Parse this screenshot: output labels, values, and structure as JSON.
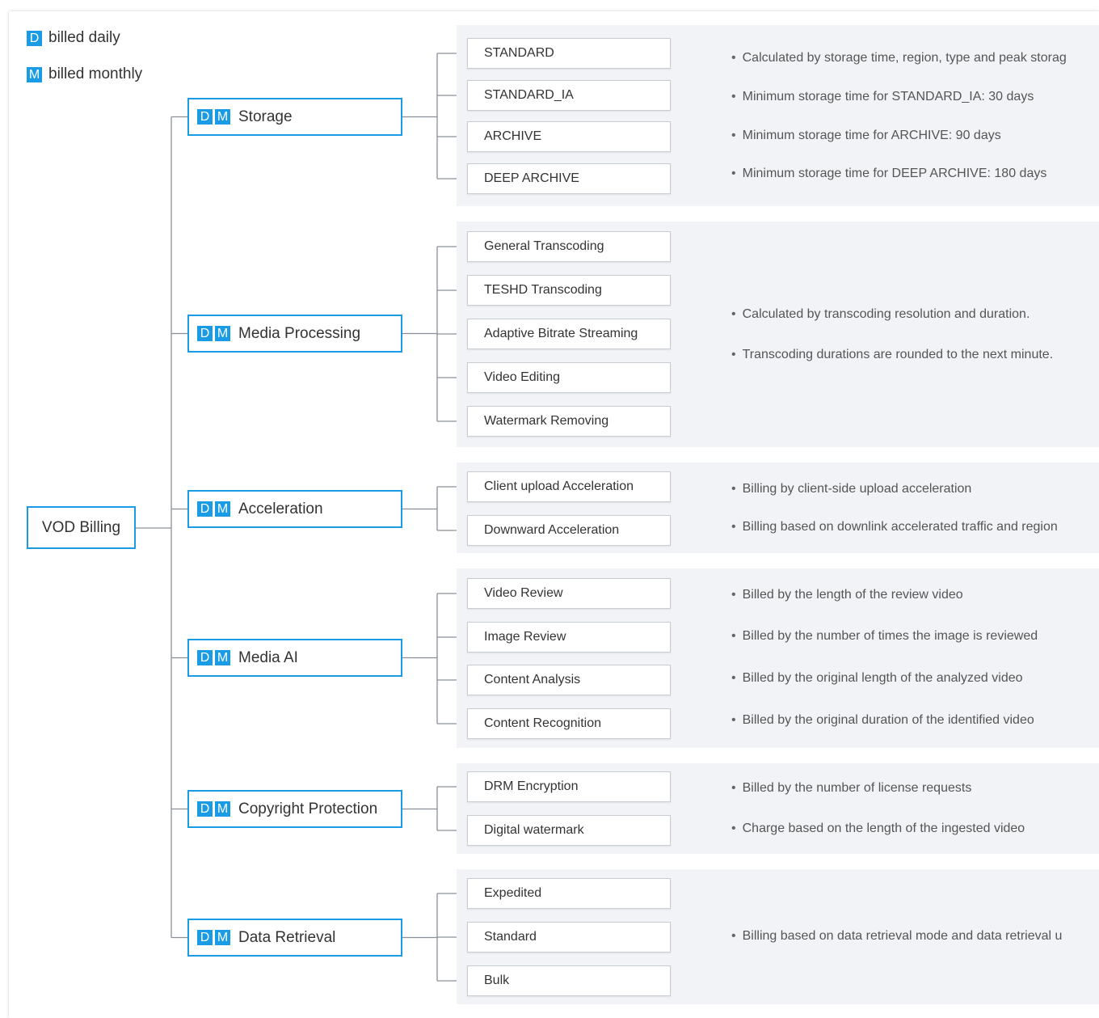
{
  "legend": [
    {
      "badge": "D",
      "label": "billed daily"
    },
    {
      "badge": "M",
      "label": "billed monthly"
    }
  ],
  "root": {
    "label": "VOD Billing"
  },
  "categories": [
    {
      "label": "Storage",
      "badges": [
        "D",
        "M"
      ],
      "items": [
        "STANDARD",
        "STANDARD_IA",
        "ARCHIVE",
        "DEEP ARCHIVE"
      ],
      "notes": [
        "Calculated by storage time, region, type and peak storag",
        "Minimum storage time for STANDARD_IA: 30 days",
        "Minimum storage time for ARCHIVE: 90 days",
        "Minimum storage time for DEEP ARCHIVE: 180 days"
      ]
    },
    {
      "label": "Media Processing",
      "badges": [
        "D",
        "M"
      ],
      "items": [
        "General Transcoding",
        "TESHD Transcoding",
        "Adaptive Bitrate Streaming",
        "Video Editing",
        "Watermark Removing"
      ],
      "notes": [
        "Calculated by transcoding resolution and duration.",
        "Transcoding durations are rounded to the next minute."
      ]
    },
    {
      "label": "Acceleration",
      "badges": [
        "D",
        "M"
      ],
      "items": [
        "Client upload Acceleration",
        "Downward Acceleration"
      ],
      "notes": [
        "Billing by client-side upload acceleration",
        "Billing based on downlink accelerated traffic and region"
      ]
    },
    {
      "label": "Media AI",
      "badges": [
        "D",
        "M"
      ],
      "items": [
        "Video Review",
        "Image Review",
        "Content Analysis",
        "Content Recognition"
      ],
      "notes": [
        "Billed by the length of the review video",
        "Billed by the number of times the image is reviewed",
        "Billed by the original length of the analyzed video",
        "Billed by the original duration of the identified video"
      ]
    },
    {
      "label": "Copyright Protection",
      "badges": [
        "D",
        "M"
      ],
      "items": [
        "DRM Encryption",
        "Digital watermark"
      ],
      "notes": [
        "Billed by the number of license requests",
        "Charge based on the length of the ingested video"
      ]
    },
    {
      "label": "Data Retrieval",
      "badges": [
        "D",
        "M"
      ],
      "items": [
        "Expedited",
        "Standard",
        "Bulk"
      ],
      "notes": [
        "Billing based on data retrieval mode and data retrieval u"
      ]
    }
  ],
  "colors": {
    "accent": "#1a9be6",
    "panel": "#f2f3f6",
    "line": "#8a8f97"
  }
}
